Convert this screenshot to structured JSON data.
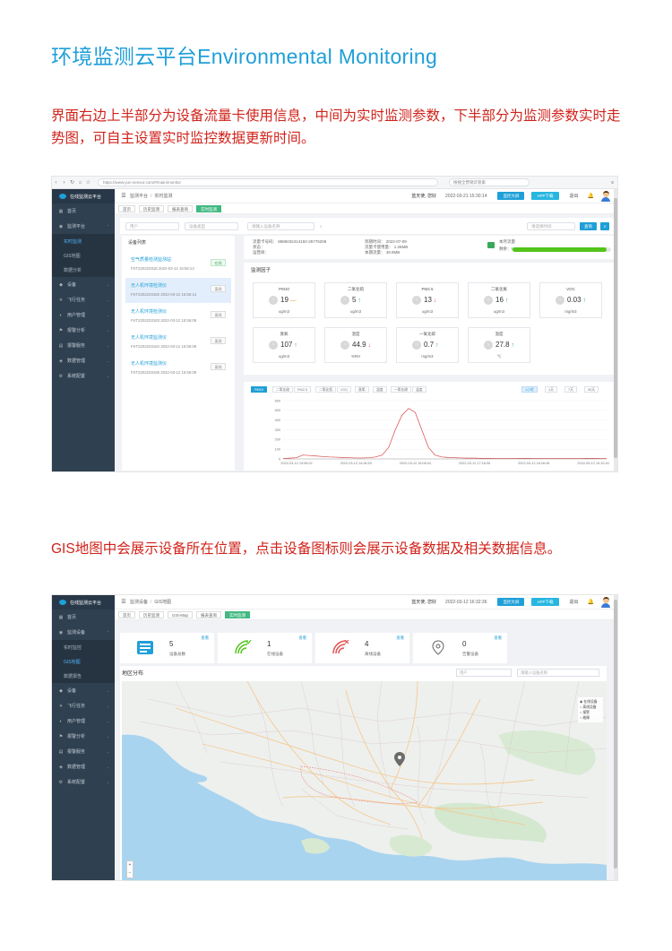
{
  "page": {
    "title": "环境监测云平台Environmental Monitoring",
    "description1": "界面右边上半部分为设备流量卡使用信息，中间为实时监测参数，下半部分为监测参数实时走势图，可自主设置实时监控数据更新时间。",
    "description2": "GIS地图中会展示设备所在位置，点击设备图标则会展示设备数据及相关数据信息。"
  },
  "shot1": {
    "browser": {
      "url": "https://www.yun-sensor.com/#/main/monitor",
      "search": "搜搜全营销云管家",
      "end": "≡"
    },
    "logo": "在线监测云平台",
    "sidebar": [
      {
        "icon": "▦",
        "label": "首页",
        "arrow": ""
      },
      {
        "icon": "◉",
        "label": "监测平台",
        "arrow": "⌃"
      },
      {
        "sub": "实时监测",
        "active": true
      },
      {
        "sub": "GIS地图",
        "active": false
      },
      {
        "sub": "数据分析",
        "active": false
      },
      {
        "icon": "◆",
        "label": "设备",
        "arrow": "⌄"
      },
      {
        "icon": "✈",
        "label": "飞行任务",
        "arrow": "⌄"
      },
      {
        "icon": "◐",
        "label": "用户管理",
        "arrow": "⌄"
      },
      {
        "icon": "⚑",
        "label": "报警分析",
        "arrow": "⌄"
      },
      {
        "icon": "▤",
        "label": "报警服务",
        "arrow": "⌄"
      },
      {
        "icon": "◈",
        "label": "数据管理",
        "arrow": "⌄"
      },
      {
        "icon": "⚙",
        "label": "系统配置",
        "arrow": "⌄"
      }
    ],
    "topbar": {
      "crumb1": "监测平台",
      "crumb2": "实时监测",
      "user": "蓝天使, 您好",
      "time": "2022-03-21 15:30:14",
      "btn1": "监控大屏",
      "btn2": "APP下载",
      "text1": "退出"
    },
    "tabs": [
      "首页",
      "历史监测",
      "报表查询",
      "实时监测"
    ],
    "filters": {
      "f1": "用户",
      "f2": "设备类型",
      "f3": "请输入设备名称",
      "f4": "请选择时间",
      "search": "查询",
      "extra": "≡"
    },
    "device_list": {
      "title": "设备列表",
      "items": [
        {
          "name": "空气质量检测监测站",
          "meta": "FKT220220318  2022-03-12 15:56:14",
          "badge": "在线",
          "on": true,
          "selected": false
        },
        {
          "name": "无人机环境检测仪",
          "meta": "FKT2202203182  2022-03-12 15:56:14",
          "badge": "离线",
          "on": false,
          "selected": true
        },
        {
          "name": "无人机环境检测仪",
          "meta": "FKT2202203183  2022-03-12 15:56:09",
          "badge": "离线",
          "on": false,
          "selected": false
        },
        {
          "name": "无人机环境监测仪",
          "meta": "FKT2202203184  2022-03-12 15:56:09",
          "badge": "离线",
          "on": false,
          "selected": false
        },
        {
          "name": "无人机环境监测仪",
          "meta": "FKT2202203185  2022-03-12 15:56:09",
          "badge": "离线",
          "on": false,
          "selected": false
        }
      ]
    },
    "info": {
      "c1": [
        "流量卡号码：  8986032414192-25776208",
        "状态：",
        "运营商："
      ],
      "c2": [
        "到期时间：  2022-07-09",
        "流量卡使用量：  1.26MB",
        "本期流量：  49.9MB"
      ],
      "traffic_label": "本月流量",
      "traffic_pct_label": "剩余：",
      "traffic_pct": "95%",
      "traffic_fraction": 0.95
    },
    "factors": {
      "title": "监测因子",
      "cards": [
        {
          "label": "PM10",
          "value": "19",
          "trend": "dash",
          "unit": "ug/m3"
        },
        {
          "label": "二氧化硫",
          "value": "5",
          "trend": "up",
          "unit": "ug/m3"
        },
        {
          "label": "PM2.5",
          "value": "13",
          "trend": "down",
          "unit": "ug/m3"
        },
        {
          "label": "二氧化氮",
          "value": "16",
          "trend": "up",
          "unit": "ug/m3"
        },
        {
          "label": "VOC",
          "value": "0.03",
          "trend": "up",
          "unit": "mg/m3"
        },
        {
          "label": "臭氧",
          "value": "107",
          "trend": "up",
          "unit": "ug/m3"
        },
        {
          "label": "湿度",
          "value": "44.9",
          "trend": "down",
          "unit": "%RH"
        },
        {
          "label": "一氧化碳",
          "value": "0.7",
          "trend": "up",
          "unit": "mg/m3"
        },
        {
          "label": "温度",
          "value": "27.8",
          "trend": "up",
          "unit": "℃"
        }
      ]
    },
    "chart_tabs": [
      "PM10",
      "二氧化硫",
      "PM2.5",
      "二氧化氮",
      "VOC",
      "臭氧",
      "湿度",
      "一氧化碳",
      "温度"
    ],
    "chart_btns": [
      "1小时",
      "1天",
      "7天",
      "30天"
    ],
    "chart_data": {
      "type": "line",
      "ylim": [
        0,
        600
      ],
      "yticks": [
        "600",
        "500",
        "400",
        "300",
        "200",
        "100",
        "0"
      ],
      "xticks": [
        "2022-03-12 15:06:02",
        "2022-03-12 14:06:53",
        "2022-03-12 16:06:04",
        "2022-03-12 17:16:06",
        "2022-03-12 18:26:06",
        "2022-03-12 19:10:16"
      ],
      "series": [
        {
          "color": "#d64545",
          "values": [
            5,
            8,
            12,
            40,
            35,
            30,
            25,
            20,
            18,
            15,
            12,
            10,
            10,
            12,
            20,
            40,
            120,
            300,
            450,
            520,
            480,
            300,
            120,
            40,
            20,
            15,
            12,
            10,
            8,
            8,
            6,
            6,
            5,
            5,
            5,
            5,
            6,
            6,
            5,
            5,
            5,
            5,
            5,
            5,
            5,
            5,
            6,
            6,
            5,
            5
          ]
        }
      ]
    }
  },
  "shot2": {
    "logo": "在线监测云平台",
    "sidebar": [
      {
        "icon": "▦",
        "label": "首页",
        "arrow": ""
      },
      {
        "icon": "◉",
        "label": "监测设备",
        "arrow": "⌃"
      },
      {
        "sub": "实时监控",
        "active": false
      },
      {
        "sub": "GIS地图",
        "active": true
      },
      {
        "sub": "数据报告",
        "active": false
      },
      {
        "icon": "◆",
        "label": "设备",
        "arrow": "⌄"
      },
      {
        "icon": "✈",
        "label": "飞行任务",
        "arrow": "⌄"
      },
      {
        "icon": "◐",
        "label": "用户管理",
        "arrow": "⌄"
      },
      {
        "icon": "⚑",
        "label": "报警分析",
        "arrow": "⌄"
      },
      {
        "icon": "▤",
        "label": "报警服务",
        "arrow": "⌄"
      },
      {
        "icon": "◈",
        "label": "数据管理",
        "arrow": "⌄"
      },
      {
        "icon": "⚙",
        "label": "系统配置",
        "arrow": "⌄"
      }
    ],
    "topbar": {
      "crumb1": "监测设备",
      "crumb2": "GIS地图",
      "user": "蓝天使, 您好",
      "time": "2022-03-12 16:32:36",
      "btn1": "监控大屏",
      "btn2": "APP下载",
      "text1": "退出"
    },
    "tabs": [
      "首页",
      "历史监测",
      "GIS-Map",
      "报表查询",
      "实时监测"
    ],
    "stats": [
      {
        "num": "5",
        "label": "设备总数",
        "link": "查看",
        "icon": "device"
      },
      {
        "num": "1",
        "label": "在线设备",
        "link": "查看",
        "icon": "online"
      },
      {
        "num": "4",
        "label": "离线设备",
        "link": "查看",
        "icon": "offline"
      },
      {
        "num": "0",
        "label": "告警设备",
        "link": "查看",
        "icon": "alarm"
      }
    ],
    "map": {
      "title": "地区分布",
      "select": "用户",
      "search": "请输入设备名称",
      "legend": [
        "◉ 在线设备",
        "○ 离线设备",
        "○ 报警",
        "○ 故障"
      ],
      "zoom_in": "+",
      "zoom_out": "−"
    }
  }
}
